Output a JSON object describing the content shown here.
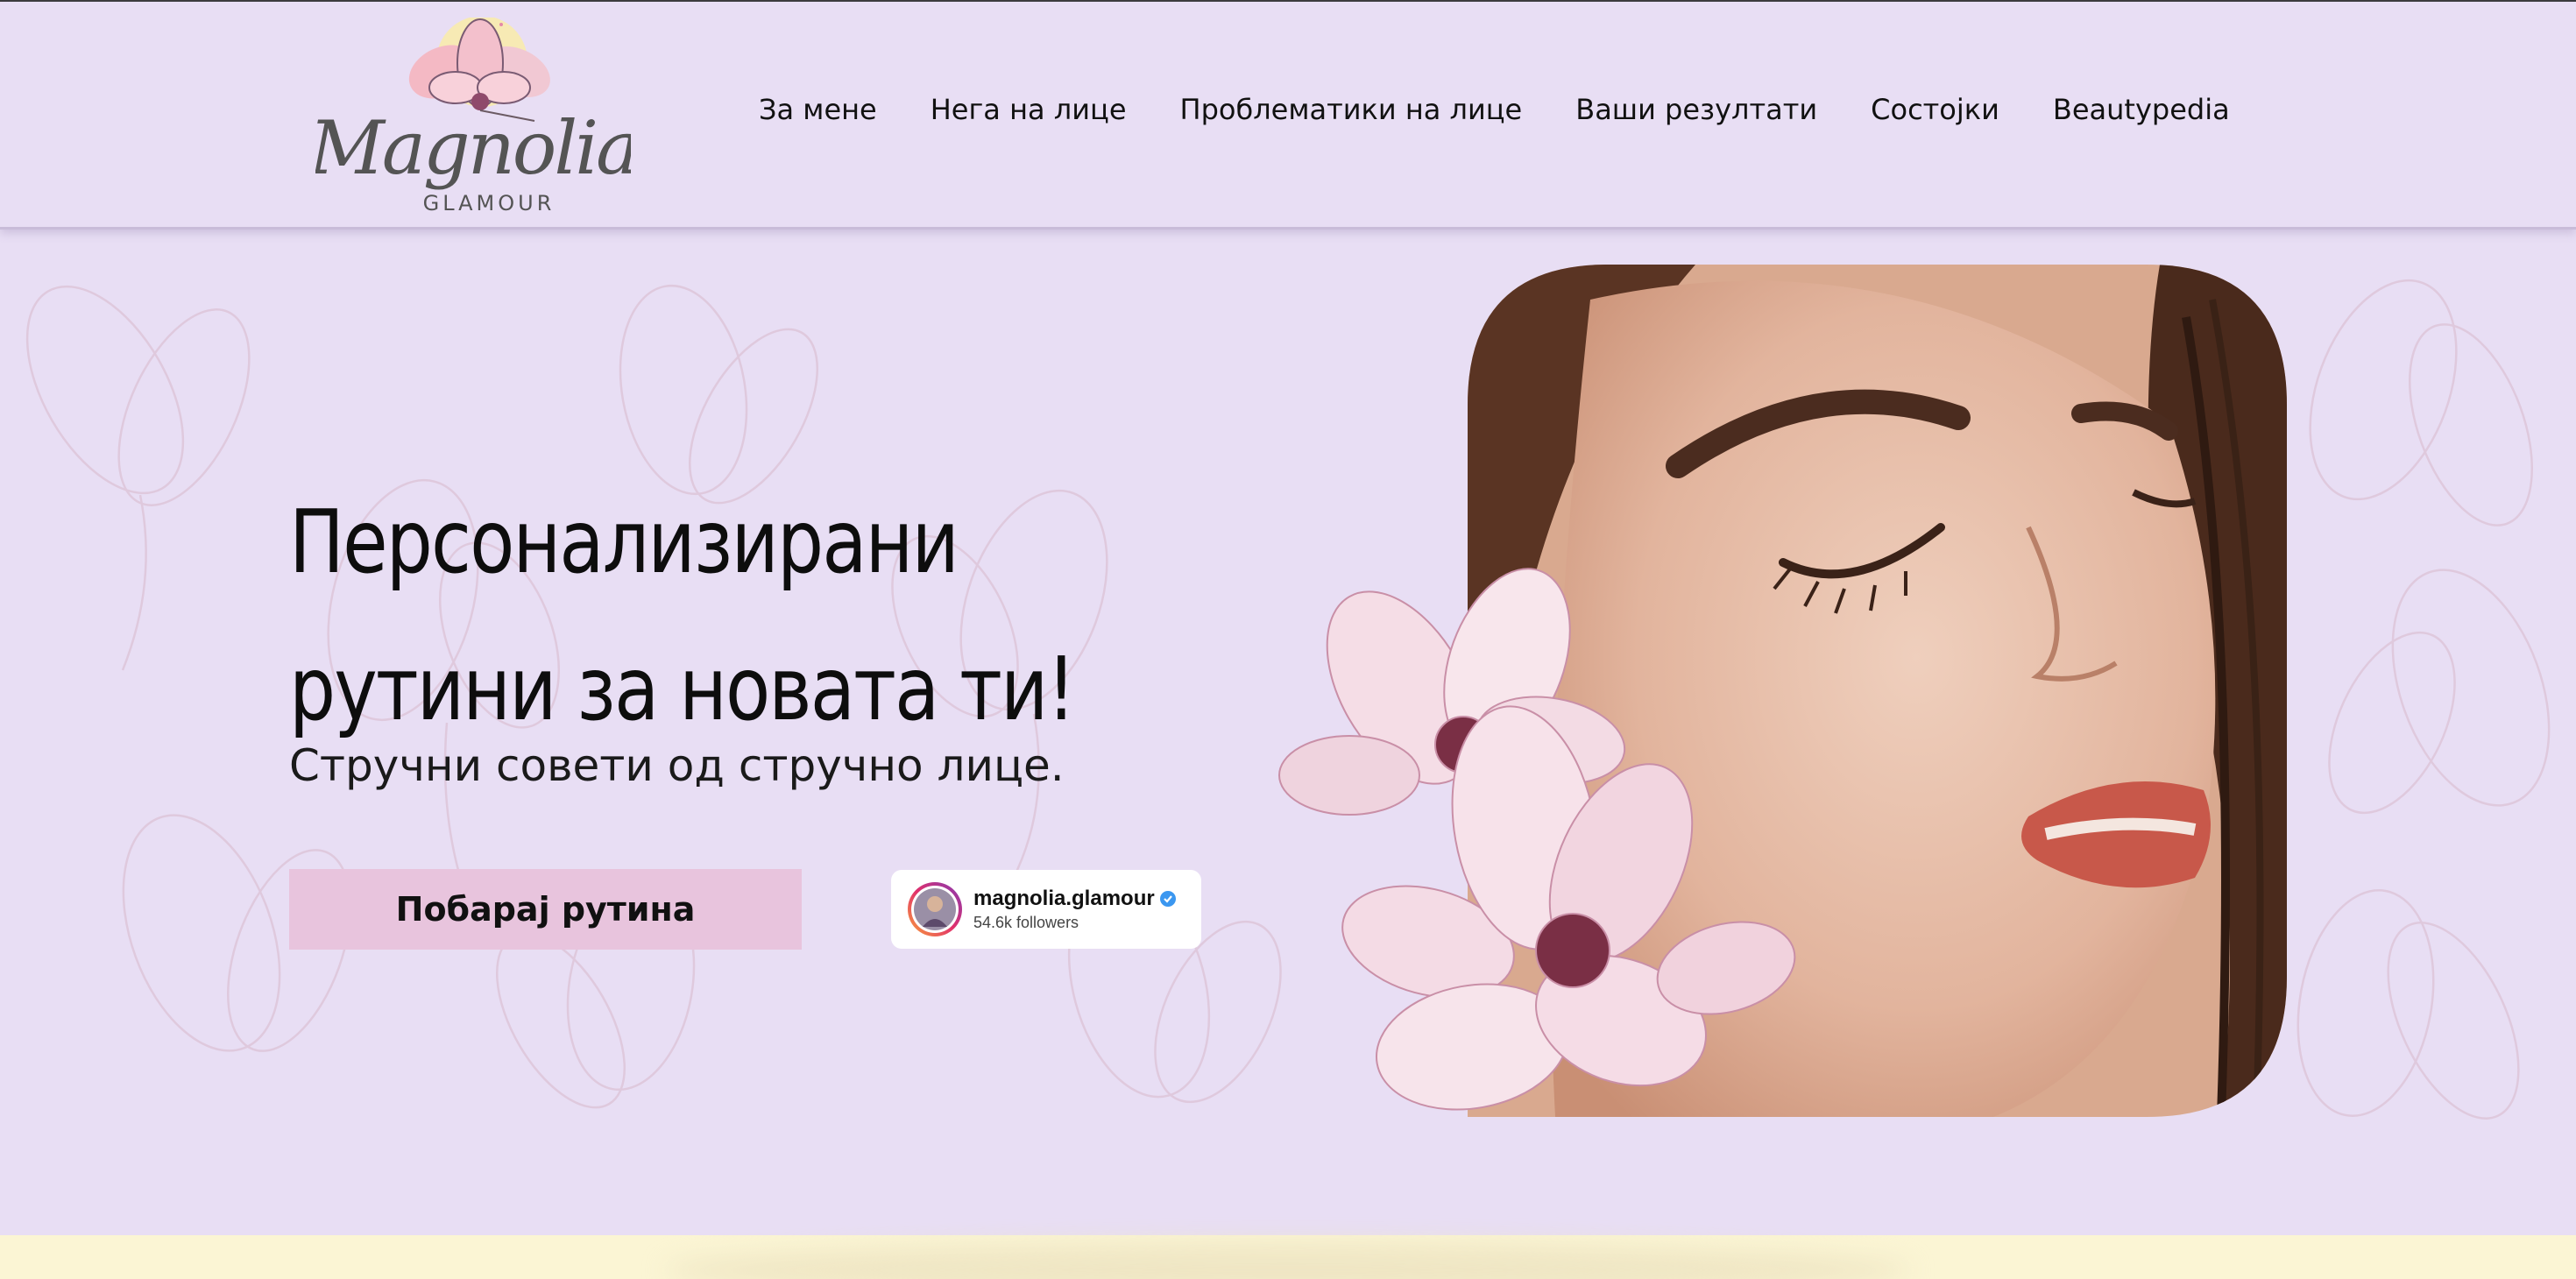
{
  "brand": {
    "name": "Magnolia",
    "tagline": "GLAMOUR"
  },
  "nav": {
    "items": [
      {
        "label": "За мене"
      },
      {
        "label": "Нега на лице"
      },
      {
        "label": "Проблематики на лице"
      },
      {
        "label": "Ваши резултати"
      },
      {
        "label": "Состојки"
      },
      {
        "label": "Beautypedia"
      }
    ]
  },
  "hero": {
    "title_line1": "Персонализирани",
    "title_line2": "рутини за новата ти!",
    "subtitle": "Стручни совети од стручно лице.",
    "cta_label": "Побарај рутина"
  },
  "instagram": {
    "handle": "magnolia.glamour",
    "followers": "54.6k followers",
    "verified_icon": "verified-badge-icon"
  },
  "colors": {
    "background": "#e8def4",
    "cta": "#e8c4dd",
    "text": "#111111",
    "bottom_strip": "#fbf5d4"
  }
}
